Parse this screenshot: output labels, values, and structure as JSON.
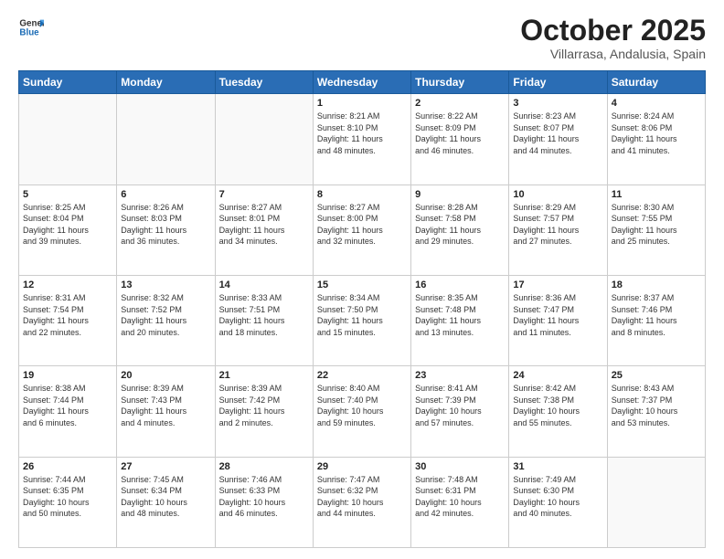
{
  "logo": {
    "line1": "General",
    "line2": "Blue"
  },
  "title": "October 2025",
  "location": "Villarrasa, Andalusia, Spain",
  "days_of_week": [
    "Sunday",
    "Monday",
    "Tuesday",
    "Wednesday",
    "Thursday",
    "Friday",
    "Saturday"
  ],
  "weeks": [
    [
      {
        "day": "",
        "info": ""
      },
      {
        "day": "",
        "info": ""
      },
      {
        "day": "",
        "info": ""
      },
      {
        "day": "1",
        "info": "Sunrise: 8:21 AM\nSunset: 8:10 PM\nDaylight: 11 hours\nand 48 minutes."
      },
      {
        "day": "2",
        "info": "Sunrise: 8:22 AM\nSunset: 8:09 PM\nDaylight: 11 hours\nand 46 minutes."
      },
      {
        "day": "3",
        "info": "Sunrise: 8:23 AM\nSunset: 8:07 PM\nDaylight: 11 hours\nand 44 minutes."
      },
      {
        "day": "4",
        "info": "Sunrise: 8:24 AM\nSunset: 8:06 PM\nDaylight: 11 hours\nand 41 minutes."
      }
    ],
    [
      {
        "day": "5",
        "info": "Sunrise: 8:25 AM\nSunset: 8:04 PM\nDaylight: 11 hours\nand 39 minutes."
      },
      {
        "day": "6",
        "info": "Sunrise: 8:26 AM\nSunset: 8:03 PM\nDaylight: 11 hours\nand 36 minutes."
      },
      {
        "day": "7",
        "info": "Sunrise: 8:27 AM\nSunset: 8:01 PM\nDaylight: 11 hours\nand 34 minutes."
      },
      {
        "day": "8",
        "info": "Sunrise: 8:27 AM\nSunset: 8:00 PM\nDaylight: 11 hours\nand 32 minutes."
      },
      {
        "day": "9",
        "info": "Sunrise: 8:28 AM\nSunset: 7:58 PM\nDaylight: 11 hours\nand 29 minutes."
      },
      {
        "day": "10",
        "info": "Sunrise: 8:29 AM\nSunset: 7:57 PM\nDaylight: 11 hours\nand 27 minutes."
      },
      {
        "day": "11",
        "info": "Sunrise: 8:30 AM\nSunset: 7:55 PM\nDaylight: 11 hours\nand 25 minutes."
      }
    ],
    [
      {
        "day": "12",
        "info": "Sunrise: 8:31 AM\nSunset: 7:54 PM\nDaylight: 11 hours\nand 22 minutes."
      },
      {
        "day": "13",
        "info": "Sunrise: 8:32 AM\nSunset: 7:52 PM\nDaylight: 11 hours\nand 20 minutes."
      },
      {
        "day": "14",
        "info": "Sunrise: 8:33 AM\nSunset: 7:51 PM\nDaylight: 11 hours\nand 18 minutes."
      },
      {
        "day": "15",
        "info": "Sunrise: 8:34 AM\nSunset: 7:50 PM\nDaylight: 11 hours\nand 15 minutes."
      },
      {
        "day": "16",
        "info": "Sunrise: 8:35 AM\nSunset: 7:48 PM\nDaylight: 11 hours\nand 13 minutes."
      },
      {
        "day": "17",
        "info": "Sunrise: 8:36 AM\nSunset: 7:47 PM\nDaylight: 11 hours\nand 11 minutes."
      },
      {
        "day": "18",
        "info": "Sunrise: 8:37 AM\nSunset: 7:46 PM\nDaylight: 11 hours\nand 8 minutes."
      }
    ],
    [
      {
        "day": "19",
        "info": "Sunrise: 8:38 AM\nSunset: 7:44 PM\nDaylight: 11 hours\nand 6 minutes."
      },
      {
        "day": "20",
        "info": "Sunrise: 8:39 AM\nSunset: 7:43 PM\nDaylight: 11 hours\nand 4 minutes."
      },
      {
        "day": "21",
        "info": "Sunrise: 8:39 AM\nSunset: 7:42 PM\nDaylight: 11 hours\nand 2 minutes."
      },
      {
        "day": "22",
        "info": "Sunrise: 8:40 AM\nSunset: 7:40 PM\nDaylight: 10 hours\nand 59 minutes."
      },
      {
        "day": "23",
        "info": "Sunrise: 8:41 AM\nSunset: 7:39 PM\nDaylight: 10 hours\nand 57 minutes."
      },
      {
        "day": "24",
        "info": "Sunrise: 8:42 AM\nSunset: 7:38 PM\nDaylight: 10 hours\nand 55 minutes."
      },
      {
        "day": "25",
        "info": "Sunrise: 8:43 AM\nSunset: 7:37 PM\nDaylight: 10 hours\nand 53 minutes."
      }
    ],
    [
      {
        "day": "26",
        "info": "Sunrise: 7:44 AM\nSunset: 6:35 PM\nDaylight: 10 hours\nand 50 minutes."
      },
      {
        "day": "27",
        "info": "Sunrise: 7:45 AM\nSunset: 6:34 PM\nDaylight: 10 hours\nand 48 minutes."
      },
      {
        "day": "28",
        "info": "Sunrise: 7:46 AM\nSunset: 6:33 PM\nDaylight: 10 hours\nand 46 minutes."
      },
      {
        "day": "29",
        "info": "Sunrise: 7:47 AM\nSunset: 6:32 PM\nDaylight: 10 hours\nand 44 minutes."
      },
      {
        "day": "30",
        "info": "Sunrise: 7:48 AM\nSunset: 6:31 PM\nDaylight: 10 hours\nand 42 minutes."
      },
      {
        "day": "31",
        "info": "Sunrise: 7:49 AM\nSunset: 6:30 PM\nDaylight: 10 hours\nand 40 minutes."
      },
      {
        "day": "",
        "info": ""
      }
    ]
  ]
}
